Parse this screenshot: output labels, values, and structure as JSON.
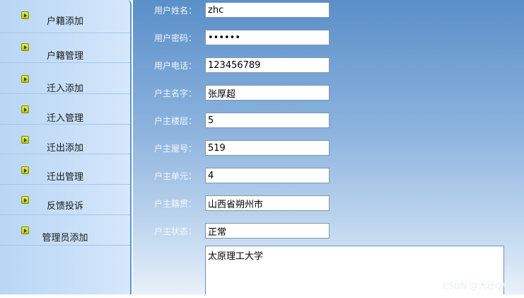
{
  "sidebar": {
    "items": [
      {
        "label": "户籍添加"
      },
      {
        "label": "户籍管理"
      },
      {
        "label": "迁入添加"
      },
      {
        "label": "迁入管理"
      },
      {
        "label": "迁出添加"
      },
      {
        "label": "迁出管理"
      },
      {
        "label": "反馈投诉"
      },
      {
        "label": "管理员添加"
      }
    ]
  },
  "form": {
    "fields": [
      {
        "label": "用户姓名：",
        "value": "zhc"
      },
      {
        "label": "用户密码：",
        "value": "••••••"
      },
      {
        "label": "用户电话：",
        "value": "123456789"
      },
      {
        "label": "户主名字：",
        "value": "张厚超"
      },
      {
        "label": "户主楼层：",
        "value": "5"
      },
      {
        "label": "户主屋号：",
        "value": "519"
      },
      {
        "label": "户主单元：",
        "value": "4"
      },
      {
        "label": "户主籍贯：",
        "value": "山西省朔州市"
      },
      {
        "label": "户主状态：",
        "value": "正常"
      }
    ],
    "notes_value": "太原理工大学"
  },
  "watermark": "CSDN @大壮QAQ",
  "colors": {
    "sidebar_bg": "#c9e0f8",
    "main_top": "#5a8fc8",
    "accent_arrow": "#c9d22e"
  }
}
